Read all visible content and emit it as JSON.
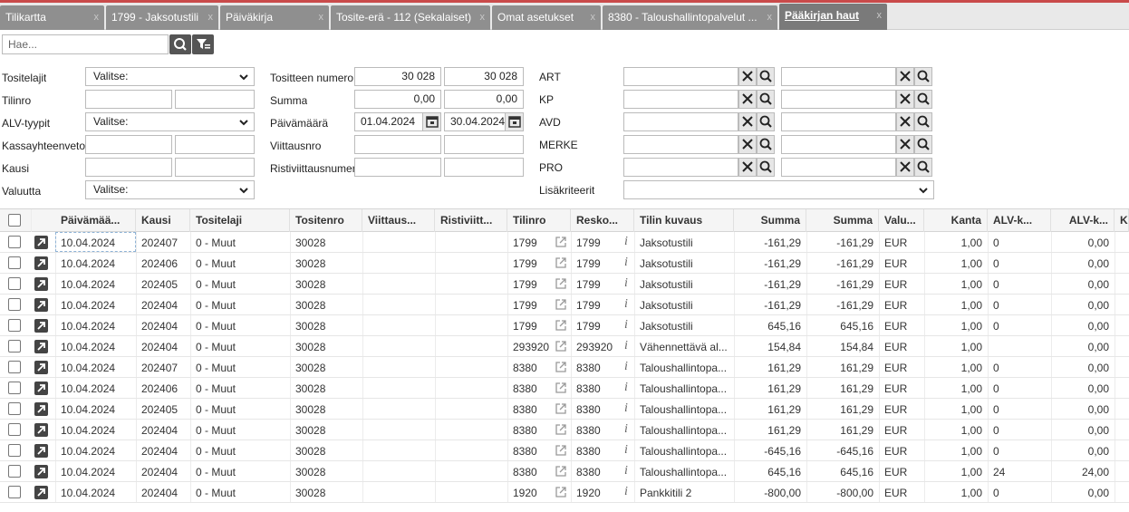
{
  "tabs": [
    {
      "label": "Tilikartta",
      "close": "x"
    },
    {
      "label": "1799 - Jaksotustili",
      "close": "x"
    },
    {
      "label": "Päiväkirja",
      "close": "x"
    },
    {
      "label": "Tosite-erä - 112 (Sekalaiset)",
      "close": "x"
    },
    {
      "label": "Omat asetukset",
      "close": "x"
    },
    {
      "label": "8380 - Taloushallintopalvelut ...",
      "close": "x"
    },
    {
      "label": "Pääkirjan haut",
      "close": "x"
    }
  ],
  "search": {
    "placeholder": "Hae..."
  },
  "filters": {
    "tositelajit": {
      "label": "Tositelajit",
      "value": "Valitse:"
    },
    "tilinro": {
      "label": "Tilinro",
      "from": "",
      "to": ""
    },
    "alv_tyypit": {
      "label": "ALV-tyypit",
      "value": "Valitse:"
    },
    "kassayhteenveto": {
      "label": "Kassayhteenveto",
      "from": "",
      "to": ""
    },
    "kausi": {
      "label": "Kausi",
      "from": "",
      "to": ""
    },
    "valuutta": {
      "label": "Valuutta",
      "value": "Valitse:"
    },
    "tositteen_numero": {
      "label": "Tositteen numero",
      "from": "30 028",
      "to": "30 028"
    },
    "summa": {
      "label": "Summa",
      "from": "0,00",
      "to": "0,00"
    },
    "paivamaara": {
      "label": "Päivämäärä",
      "from": "01.04.2024",
      "to": "30.04.2024"
    },
    "viittausnro": {
      "label": "Viittausnro",
      "from": "",
      "to": ""
    },
    "ristiviittausnumero": {
      "label": "Ristiviittausnumero",
      "from": "",
      "to": ""
    },
    "art": {
      "label": "ART"
    },
    "kp": {
      "label": "KP"
    },
    "avd": {
      "label": "AVD"
    },
    "merke": {
      "label": "MERKE"
    },
    "pro": {
      "label": "PRO"
    },
    "lisakriteerit": {
      "label": "Lisäkriteerit",
      "value": ""
    }
  },
  "columns": [
    "Päivämää...",
    "Kausi",
    "Tositelaji",
    "Tositenro",
    "Viittaus...",
    "Ristiviitt...",
    "Tilinro",
    "Resko...",
    "Tilin kuvaus",
    "Summa",
    "Summa",
    "Valu...",
    "Kanta",
    "ALV-k...",
    "ALV-k...",
    "Ku"
  ],
  "rows": [
    {
      "date": "10.04.2024",
      "kausi": "202407",
      "laji": "0 - Muut",
      "nro": "30028",
      "tilinro": "1799",
      "resko": "1799",
      "kuvaus": "Jaksotustili",
      "summa1": "-161,29",
      "summa2": "-161,29",
      "valuutta": "EUR",
      "kanta": "1,00",
      "alvk": "0",
      "alvk2": "0,00"
    },
    {
      "date": "10.04.2024",
      "kausi": "202406",
      "laji": "0 - Muut",
      "nro": "30028",
      "tilinro": "1799",
      "resko": "1799",
      "kuvaus": "Jaksotustili",
      "summa1": "-161,29",
      "summa2": "-161,29",
      "valuutta": "EUR",
      "kanta": "1,00",
      "alvk": "0",
      "alvk2": "0,00"
    },
    {
      "date": "10.04.2024",
      "kausi": "202405",
      "laji": "0 - Muut",
      "nro": "30028",
      "tilinro": "1799",
      "resko": "1799",
      "kuvaus": "Jaksotustili",
      "summa1": "-161,29",
      "summa2": "-161,29",
      "valuutta": "EUR",
      "kanta": "1,00",
      "alvk": "0",
      "alvk2": "0,00"
    },
    {
      "date": "10.04.2024",
      "kausi": "202404",
      "laji": "0 - Muut",
      "nro": "30028",
      "tilinro": "1799",
      "resko": "1799",
      "kuvaus": "Jaksotustili",
      "summa1": "-161,29",
      "summa2": "-161,29",
      "valuutta": "EUR",
      "kanta": "1,00",
      "alvk": "0",
      "alvk2": "0,00"
    },
    {
      "date": "10.04.2024",
      "kausi": "202404",
      "laji": "0 - Muut",
      "nro": "30028",
      "tilinro": "1799",
      "resko": "1799",
      "kuvaus": "Jaksotustili",
      "summa1": "645,16",
      "summa2": "645,16",
      "valuutta": "EUR",
      "kanta": "1,00",
      "alvk": "0",
      "alvk2": "0,00"
    },
    {
      "date": "10.04.2024",
      "kausi": "202404",
      "laji": "0 - Muut",
      "nro": "30028",
      "tilinro": "293920",
      "resko": "293920",
      "kuvaus": "Vähennettävä al...",
      "summa1": "154,84",
      "summa2": "154,84",
      "valuutta": "EUR",
      "kanta": "1,00",
      "alvk": "",
      "alvk2": "0,00"
    },
    {
      "date": "10.04.2024",
      "kausi": "202407",
      "laji": "0 - Muut",
      "nro": "30028",
      "tilinro": "8380",
      "resko": "8380",
      "kuvaus": "Taloushallintopa...",
      "summa1": "161,29",
      "summa2": "161,29",
      "valuutta": "EUR",
      "kanta": "1,00",
      "alvk": "0",
      "alvk2": "0,00"
    },
    {
      "date": "10.04.2024",
      "kausi": "202406",
      "laji": "0 - Muut",
      "nro": "30028",
      "tilinro": "8380",
      "resko": "8380",
      "kuvaus": "Taloushallintopa...",
      "summa1": "161,29",
      "summa2": "161,29",
      "valuutta": "EUR",
      "kanta": "1,00",
      "alvk": "0",
      "alvk2": "0,00"
    },
    {
      "date": "10.04.2024",
      "kausi": "202405",
      "laji": "0 - Muut",
      "nro": "30028",
      "tilinro": "8380",
      "resko": "8380",
      "kuvaus": "Taloushallintopa...",
      "summa1": "161,29",
      "summa2": "161,29",
      "valuutta": "EUR",
      "kanta": "1,00",
      "alvk": "0",
      "alvk2": "0,00"
    },
    {
      "date": "10.04.2024",
      "kausi": "202404",
      "laji": "0 - Muut",
      "nro": "30028",
      "tilinro": "8380",
      "resko": "8380",
      "kuvaus": "Taloushallintopa...",
      "summa1": "161,29",
      "summa2": "161,29",
      "valuutta": "EUR",
      "kanta": "1,00",
      "alvk": "0",
      "alvk2": "0,00"
    },
    {
      "date": "10.04.2024",
      "kausi": "202404",
      "laji": "0 - Muut",
      "nro": "30028",
      "tilinro": "8380",
      "resko": "8380",
      "kuvaus": "Taloushallintopa...",
      "summa1": "-645,16",
      "summa2": "-645,16",
      "valuutta": "EUR",
      "kanta": "1,00",
      "alvk": "0",
      "alvk2": "0,00"
    },
    {
      "date": "10.04.2024",
      "kausi": "202404",
      "laji": "0 - Muut",
      "nro": "30028",
      "tilinro": "8380",
      "resko": "8380",
      "kuvaus": "Taloushallintopa...",
      "summa1": "645,16",
      "summa2": "645,16",
      "valuutta": "EUR",
      "kanta": "1,00",
      "alvk": "24",
      "alvk2": "24,00"
    },
    {
      "date": "10.04.2024",
      "kausi": "202404",
      "laji": "0 - Muut",
      "nro": "30028",
      "tilinro": "1920",
      "resko": "1920",
      "kuvaus": "Pankkitili 2",
      "summa1": "-800,00",
      "summa2": "-800,00",
      "valuutta": "EUR",
      "kanta": "1,00",
      "alvk": "0",
      "alvk2": "0,00"
    }
  ],
  "icons": {
    "search": "search-icon",
    "filter": "filter-icon",
    "clear": "close-icon",
    "lookup": "search-icon",
    "calendar": "calendar-icon",
    "open": "open-arrow-icon",
    "external": "external-link-icon",
    "info": "info-icon"
  },
  "colors": {
    "tab_bg": "#8f8f8f",
    "tab_active": "#7a7a7a",
    "accent_line": "#c94a4a",
    "button_dark": "#555555"
  }
}
